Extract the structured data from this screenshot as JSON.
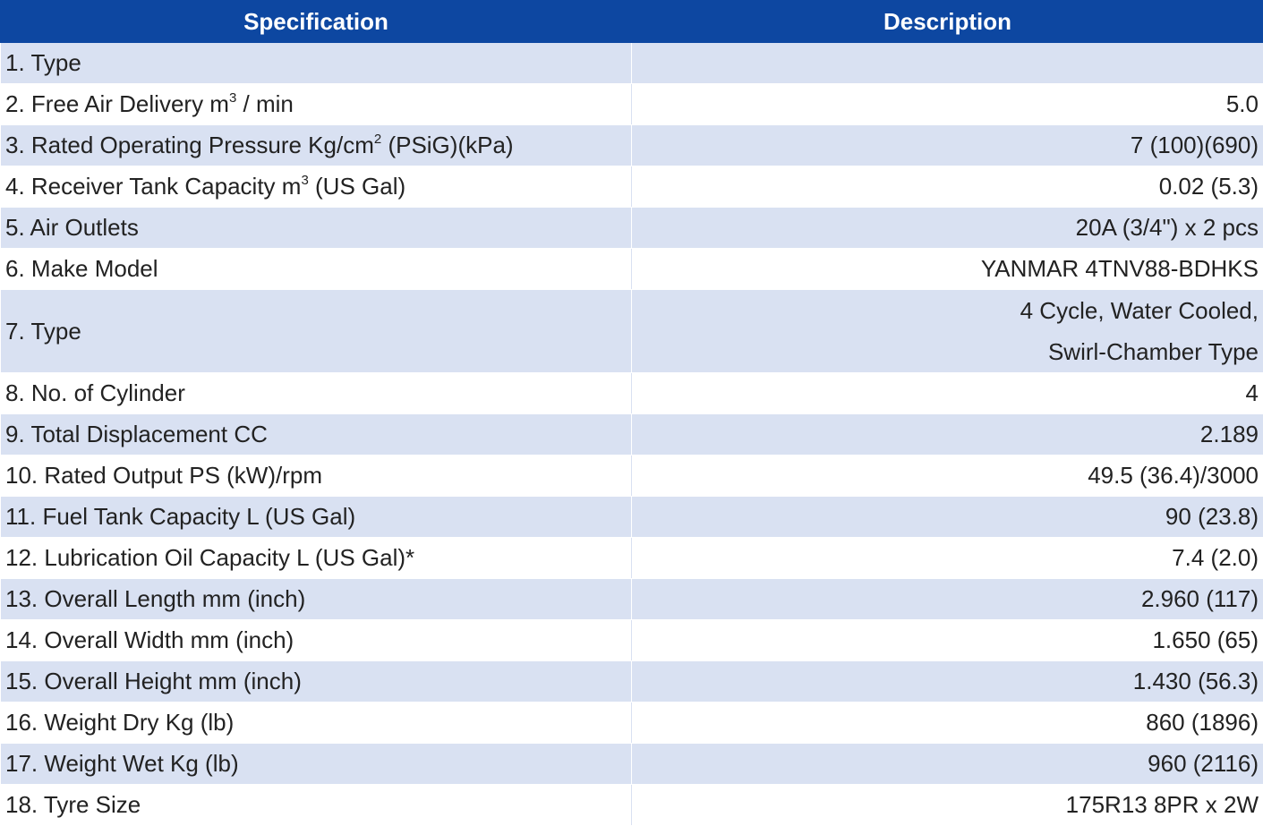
{
  "header": {
    "spec": "Specification",
    "desc": "Description"
  },
  "rows": [
    {
      "spec": "1. Type",
      "desc": ""
    },
    {
      "spec": "2. Free Air Delivery m",
      "sup": "3",
      "spec_after": " / min",
      "desc": "5.0"
    },
    {
      "spec": "3. Rated Operating Pressure Kg/cm",
      "sup": "2",
      "spec_after": " (PSiG)(kPa)",
      "desc": "7 (100)(690)"
    },
    {
      "spec": "4. Receiver Tank Capacity m",
      "sup": "3",
      "spec_after": " (US Gal)",
      "desc": "0.02 (5.3)"
    },
    {
      "spec": "5. Air Outlets",
      "desc": "20A (3/4\") x 2 pcs"
    },
    {
      "spec": "6. Make Model",
      "desc": "YANMAR 4TNV88-BDHKS"
    },
    {
      "spec": "7. Type",
      "desc": "4 Cycle, Water Cooled,",
      "desc_line2": "Swirl-Chamber Type"
    },
    {
      "spec": "8. No. of Cylinder",
      "desc": "4"
    },
    {
      "spec": "9. Total Displacement CC",
      "desc": "2.189"
    },
    {
      "spec": "10. Rated Output PS (kW)/rpm",
      "desc": "49.5 (36.4)/3000"
    },
    {
      "spec": "11. Fuel Tank Capacity L (US Gal)",
      "desc": "90 (23.8)"
    },
    {
      "spec": "12. Lubrication Oil Capacity L (US Gal)*",
      "desc": "7.4 (2.0)"
    },
    {
      "spec": "13. Overall Length mm (inch)",
      "desc": "2.960 (117)"
    },
    {
      "spec": "14. Overall Width mm (inch)",
      "desc": "1.650 (65)"
    },
    {
      "spec": "15. Overall Height mm (inch)",
      "desc": "1.430 (56.3)"
    },
    {
      "spec": "16. Weight Dry Kg (lb)",
      "desc": "860 (1896)"
    },
    {
      "spec": "17. Weight Wet Kg (lb)",
      "desc": "960 (2116)"
    },
    {
      "spec": "18. Tyre Size",
      "desc": "175R13 8PR x 2W"
    }
  ],
  "colors": {
    "header_bg": "#0d47a1",
    "row_alt_bg": "#d9e1f2",
    "row_bg": "#ffffff"
  }
}
